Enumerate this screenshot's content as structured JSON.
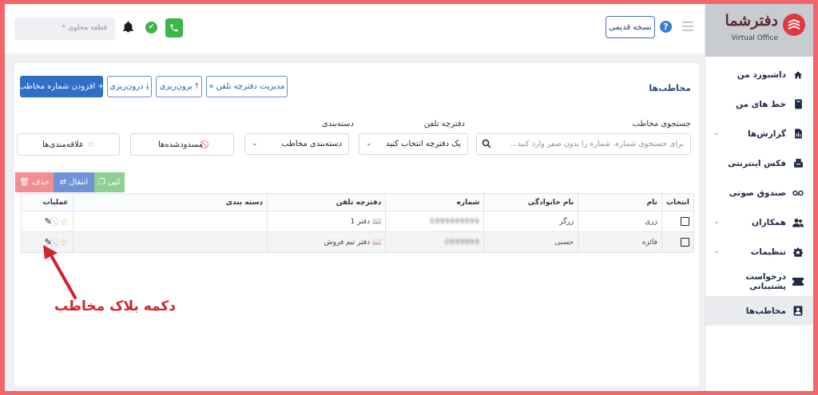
{
  "brand": {
    "name": "دفترشما",
    "subtitle": "Virtual Office"
  },
  "topbar": {
    "old_version_label": "نسخه قدیمی",
    "help_glyph": "?",
    "status_placeholder": "قطعه محلوی *"
  },
  "sidebar": {
    "items": [
      {
        "label": "داشبورد من",
        "icon": "home-icon"
      },
      {
        "label": "خط های من",
        "icon": "phone-book-icon"
      },
      {
        "label": "گزارش‌ها",
        "icon": "report-icon",
        "has_caret": true
      },
      {
        "label": "فکس اینترنتی",
        "icon": "fax-icon"
      },
      {
        "label": "صندوق صوتی",
        "icon": "voicemail-icon"
      },
      {
        "label": "همکاران",
        "icon": "users-icon",
        "has_caret": true
      },
      {
        "label": "تنظیمات",
        "icon": "gear-icon",
        "has_caret": true
      },
      {
        "label": "درخواست پشتیبانی",
        "icon": "ticket-icon"
      },
      {
        "label": "مخاطب‌ها",
        "icon": "contact-icon",
        "active": true
      }
    ]
  },
  "main": {
    "title": "مخاطب‌ها",
    "buttons": {
      "add_contact": "افزودن شماره مخاطب",
      "import": "درون‌ریزی",
      "export": "برون‌ریزی",
      "manage_phonebook": "مدیریت دفترچه تلفن"
    },
    "filters": {
      "search_label": "جستجوی مخاطب",
      "search_placeholder": "برای جستجوی شماره، شماره را بدون صفر وارد کنید...",
      "phonebook_label": "دفترچه تلفن",
      "phonebook_value": "یک دفترچه انتخاب کنید",
      "category_label": "دسته‌بندی",
      "category_value": "دسته‌بندی مخاطب",
      "blocked_label": "مسدودشده‌ها",
      "favorites_label": "علاقه‌مندی‌ها"
    },
    "actions": {
      "copy": "کپی",
      "move": "انتقال",
      "delete": "حذف"
    },
    "table": {
      "headers": [
        "انتخاب",
        "نام",
        "نام خانوادگی",
        "شماره",
        "دفترچه تلفن",
        "دسته بندی",
        "عملیات"
      ],
      "rows": [
        {
          "first_name": "زری",
          "last_name": "زرگر",
          "number": "0999999999",
          "phonebook": "دفتر 1",
          "category": ""
        },
        {
          "first_name": "فائزه",
          "last_name": "حسنی",
          "number": "0999999",
          "phonebook": "دفتر تیم فروش",
          "category": ""
        }
      ]
    }
  },
  "annotation": {
    "text": "دکمه بلاک مخاطب",
    "color": "#d0232a"
  },
  "colors": {
    "primary": "#2f6fc7",
    "copy": "#8fcf8f",
    "move": "#6f93d6",
    "delete": "#f08f93",
    "accent_red": "#e0383f"
  }
}
